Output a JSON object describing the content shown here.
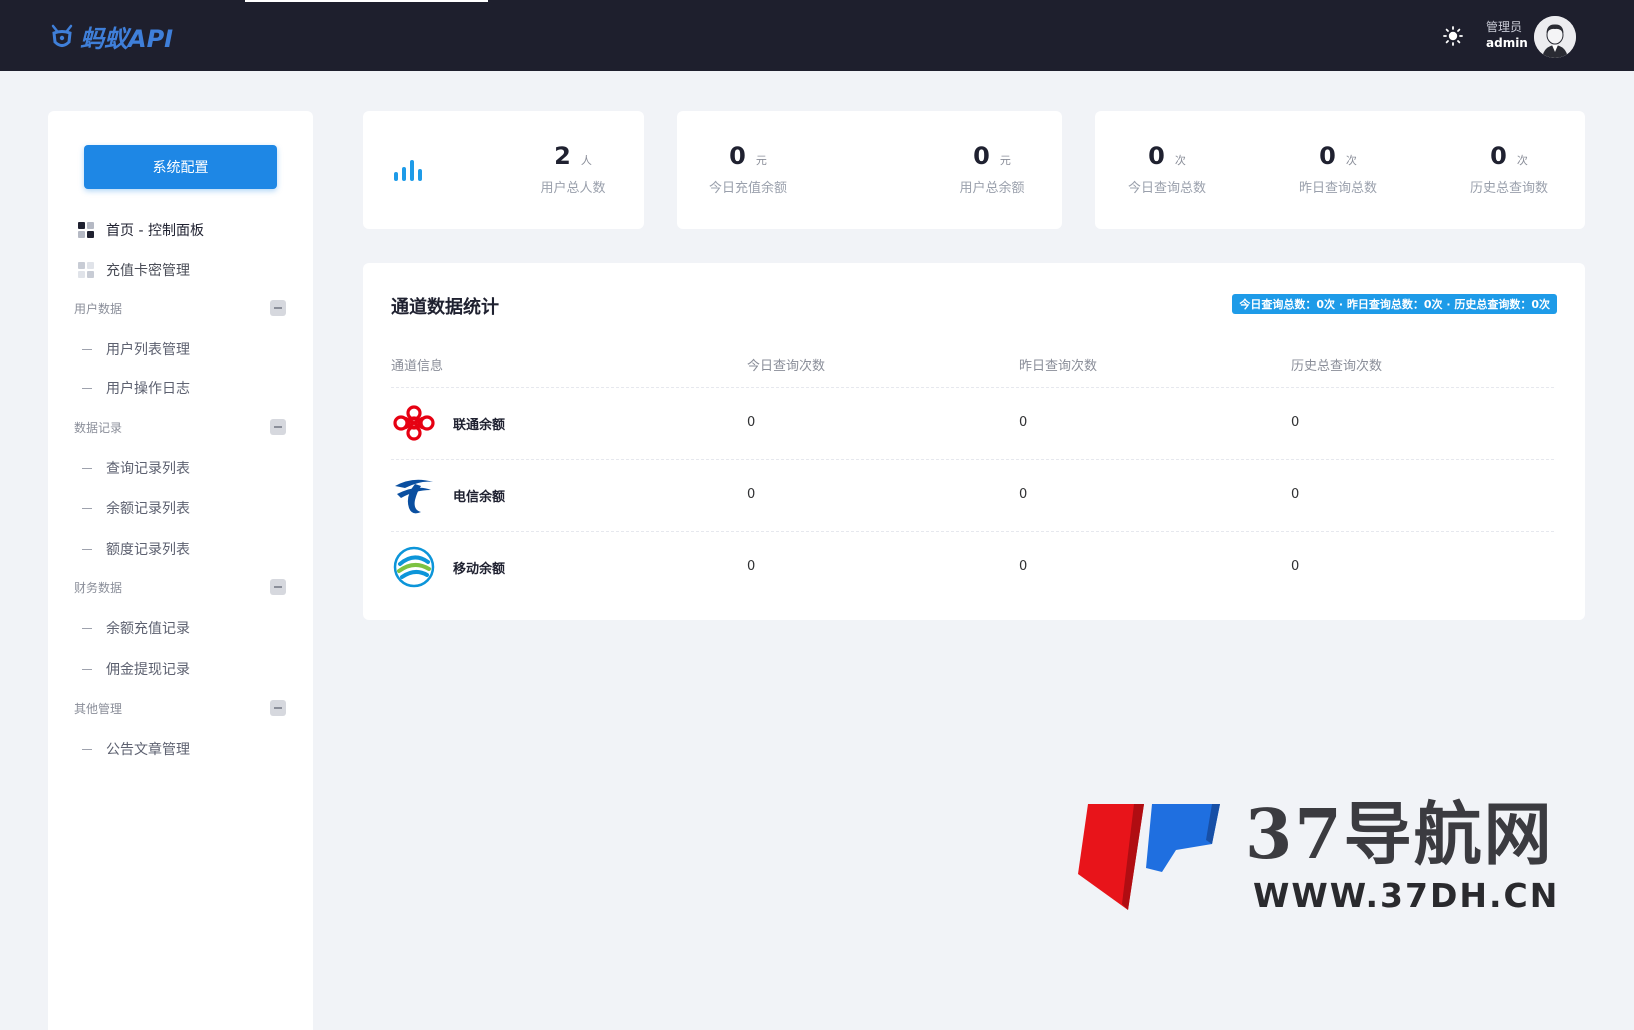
{
  "header": {
    "logo_text": "蚂蚁API",
    "user_role": "管理员",
    "user_name": "admin"
  },
  "icons": {
    "theme_toggle": "sun-icon",
    "avatar": "user-avatar-icon",
    "stats": "bar-chart-icon",
    "channel_logos": [
      "china-unicom-logo",
      "china-telecom-logo",
      "china-mobile-logo"
    ]
  },
  "colors": {
    "topbar": "#1e1f2d",
    "primary": "#1e87e5",
    "badge": "#1e9be8",
    "unicom": "#e60012",
    "telecom": "#0a4fa0",
    "mobile": "#0c95d9"
  },
  "sidebar": {
    "config_button": "系统配置",
    "top_items": [
      {
        "label": "首页 - 控制面板"
      },
      {
        "label": "充值卡密管理"
      }
    ],
    "groups": [
      {
        "title": "用户数据",
        "items": [
          "用户列表管理",
          "用户操作日志"
        ]
      },
      {
        "title": "数据记录",
        "items": [
          "查询记录列表",
          "余额记录列表",
          "额度记录列表"
        ]
      },
      {
        "title": "财务数据",
        "items": [
          "余额充值记录",
          "佣金提现记录"
        ]
      },
      {
        "title": "其他管理",
        "items": [
          "公告文章管理"
        ]
      }
    ]
  },
  "stats": {
    "users": {
      "value": "2",
      "unit": "人",
      "label": "用户总人数"
    },
    "today_recharge": {
      "value": "0",
      "unit": "元",
      "label": "今日充值余额"
    },
    "user_balance": {
      "value": "0",
      "unit": "元",
      "label": "用户总余额"
    },
    "today_queries": {
      "value": "0",
      "unit": "次",
      "label": "今日查询总数"
    },
    "yesterday_queries": {
      "value": "0",
      "unit": "次",
      "label": "昨日查询总数"
    },
    "history_queries": {
      "value": "0",
      "unit": "次",
      "label": "历史总查询数"
    }
  },
  "channels": {
    "title": "通道数据统计",
    "summary": "今日查询总数：0次 · 昨日查询总数：0次 · 历史总查询数：0次",
    "columns": [
      "通道信息",
      "今日查询次数",
      "昨日查询次数",
      "历史总查询次数"
    ],
    "rows": [
      {
        "name": "联通余额",
        "today": "0",
        "yesterday": "0",
        "history": "0"
      },
      {
        "name": "电信余额",
        "today": "0",
        "yesterday": "0",
        "history": "0"
      },
      {
        "name": "移动余额",
        "today": "0",
        "yesterday": "0",
        "history": "0"
      }
    ]
  },
  "watermark": {
    "title": "37导航网",
    "url": "WWW.37DH.CN"
  }
}
